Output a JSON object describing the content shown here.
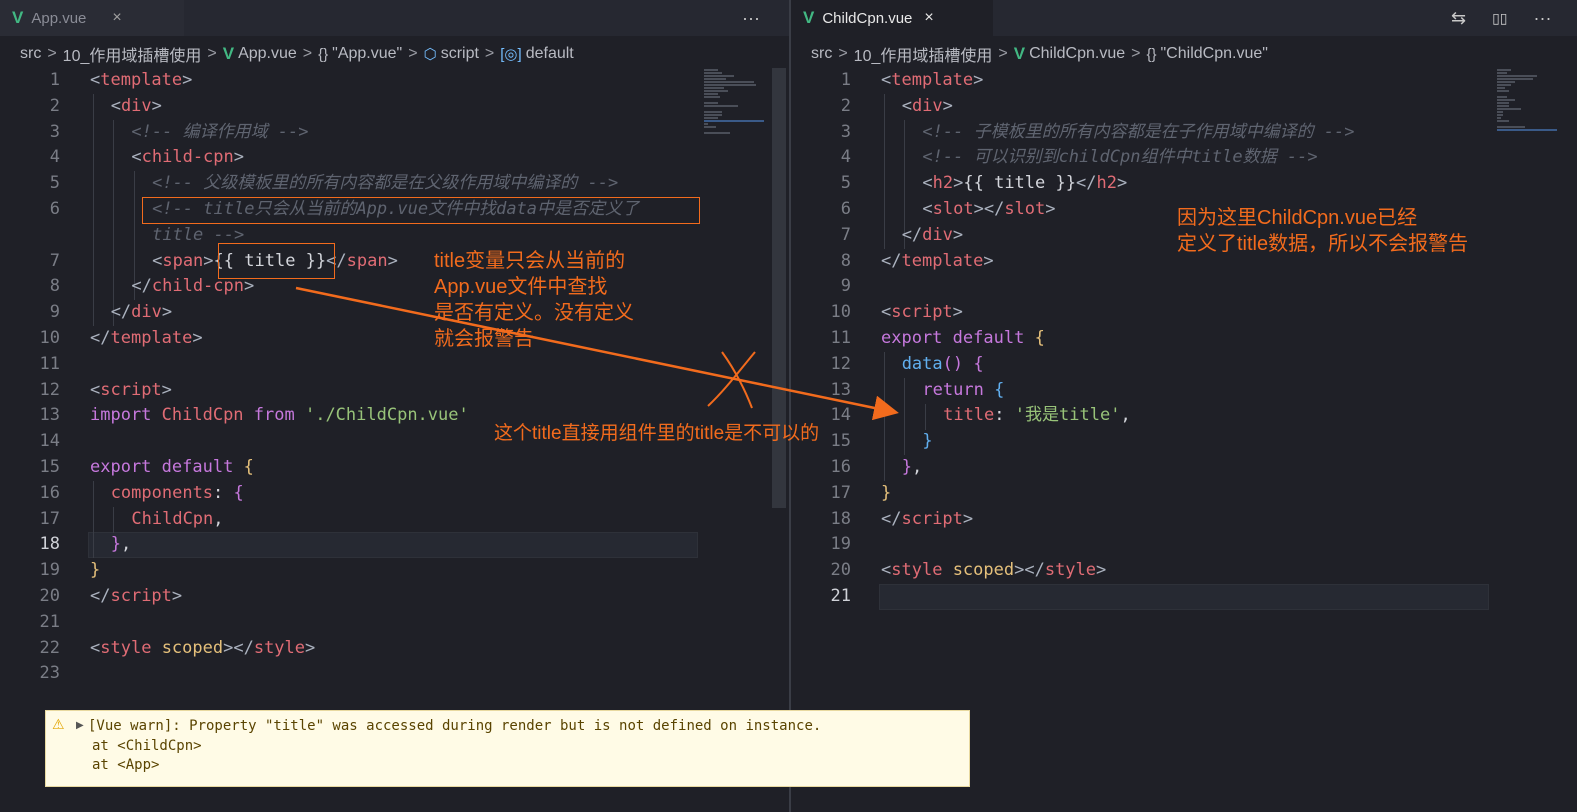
{
  "left": {
    "tab": {
      "label": "App.vue",
      "close": "×",
      "icon": "V"
    },
    "more": "···",
    "breadcrumb": [
      "src",
      "10_作用域插槽使用",
      "App.vue",
      "\"App.vue\"",
      "script",
      "default"
    ],
    "breadcrumb_icons": {
      "app": "V",
      "braces": "{}",
      "script": "⬡",
      "default": "[◎]"
    },
    "sep": ">",
    "line_numbers": [
      "1",
      "2",
      "3",
      "4",
      "5",
      "6",
      "",
      "7",
      "8",
      "9",
      "10",
      "11",
      "12",
      "13",
      "14",
      "15",
      "16",
      "17",
      "18",
      "19",
      "20",
      "21",
      "22",
      "23"
    ],
    "code": {
      "l1": [
        "<",
        "template",
        ">"
      ],
      "l2": [
        "<",
        "div",
        ">"
      ],
      "l3": "<!-- 编译作用域 -->",
      "l4": [
        "<",
        "child-cpn",
        ">"
      ],
      "l5": "<!-- 父级模板里的所有内容都是在父级作用域中编译的 -->",
      "l6a": "<!-- title只会从当前的App.vue文件中找data中是否定义了",
      "l6b": "title -->",
      "l7": [
        "<",
        "span",
        ">",
        "{{ title }}",
        "</",
        "span",
        ">"
      ],
      "l8": [
        "</",
        "child-cpn",
        ">"
      ],
      "l9": [
        "</",
        "div",
        ">"
      ],
      "l10": [
        "</",
        "template",
        ">"
      ],
      "l12": [
        "<",
        "script",
        ">"
      ],
      "l13": [
        "import",
        " ChildCpn ",
        "from",
        " './ChildCpn.vue'"
      ],
      "l15": [
        "export",
        " ",
        "default",
        " ",
        "{"
      ],
      "l16": [
        "components",
        ":",
        " ",
        "{"
      ],
      "l17": [
        "ChildCpn",
        ","
      ],
      "l18": [
        "}",
        ","
      ],
      "l19": "}",
      "l20": [
        "</",
        "script",
        ">"
      ],
      "l22": [
        "<",
        "style",
        " ",
        "scoped",
        "></",
        "style",
        ">"
      ]
    }
  },
  "right": {
    "tab": {
      "label": "ChildCpn.vue",
      "close": "×",
      "icon": "V"
    },
    "actions": {
      "compare": "⇆",
      "split": "▯▯",
      "more": "···"
    },
    "breadcrumb": [
      "src",
      "10_作用域插槽使用",
      "ChildCpn.vue",
      "\"ChildCpn.vue\""
    ],
    "breadcrumb_icons": {
      "app": "V",
      "braces": "{}"
    },
    "sep": ">",
    "line_numbers": [
      "1",
      "2",
      "3",
      "4",
      "5",
      "6",
      "7",
      "8",
      "9",
      "10",
      "11",
      "12",
      "13",
      "14",
      "15",
      "16",
      "17",
      "18",
      "19",
      "20",
      "21"
    ],
    "code": {
      "l1": [
        "<",
        "template",
        ">"
      ],
      "l2": [
        "<",
        "div",
        ">"
      ],
      "l3": "<!-- 子模板里的所有内容都是在子作用域中编译的 -->",
      "l4": "<!-- 可以识别到childCpn组件中title数据 -->",
      "l5": [
        "<",
        "h2",
        ">",
        "{{ title }}",
        "</",
        "h2",
        ">"
      ],
      "l6": [
        "<",
        "slot",
        "></",
        "slot",
        ">"
      ],
      "l7": [
        "</",
        "div",
        ">"
      ],
      "l8": [
        "</",
        "template",
        ">"
      ],
      "l10": [
        "<",
        "script",
        ">"
      ],
      "l11": [
        "export",
        " ",
        "default",
        " ",
        "{"
      ],
      "l12": [
        "data",
        "()",
        " ",
        "{"
      ],
      "l13": [
        "return",
        " ",
        "{"
      ],
      "l14": [
        "title",
        ":",
        " ",
        "'我是title'",
        ","
      ],
      "l15": "}",
      "l16": [
        "}",
        ","
      ],
      "l17": "}",
      "l18": [
        "</",
        "script",
        ">"
      ],
      "l20": [
        "<",
        "style",
        " ",
        "scoped",
        "></",
        "style",
        ">"
      ]
    }
  },
  "annotations": {
    "left_note": [
      "title变量只会从当前的",
      "App.vue文件中查找",
      "是否有定义。没有定义",
      "就会报警告"
    ],
    "arrow_note": "这个title直接用组件里的title是不可以的",
    "right_note": [
      "因为这里ChildCpn.vue已经",
      "定义了title数据，所以不会报警告"
    ]
  },
  "console_warning": {
    "icon": "⚠",
    "toggle": "▶",
    "message": "[Vue warn]: Property \"title\" was accessed during render but is not defined on instance.",
    "trace": [
      "at <ChildCpn>",
      "at <App>"
    ]
  },
  "colors": {
    "accent_orange": "#f26b1d",
    "vue_green": "#42b883",
    "warn_bg": "#fffbe6"
  }
}
